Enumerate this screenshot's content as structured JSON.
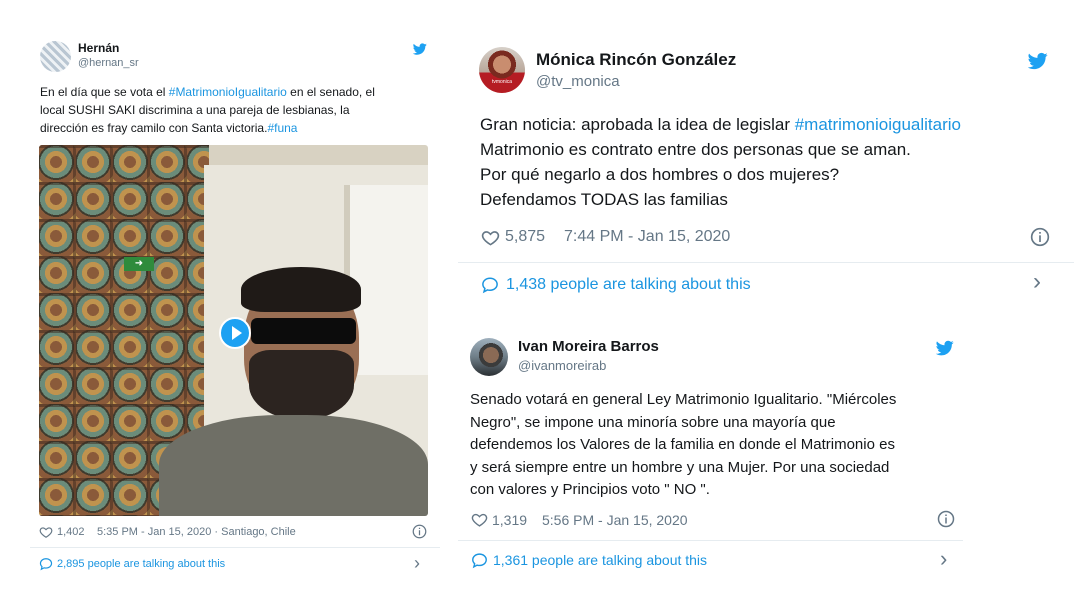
{
  "tweet1": {
    "name": "Hernán",
    "handle": "@hernan_sr",
    "text_lines": [
      [
        {
          "t": "En el día que se vota el "
        },
        {
          "t": "#MatrimonioIgualitario",
          "h": true
        },
        {
          "t": " en el senado, el"
        }
      ],
      [
        {
          "t": "local SUSHI SAKI discrimina a una pareja de lesbianas, la"
        }
      ],
      [
        {
          "t": "dirección es fray camilo con Santa victoria."
        },
        {
          "t": "#funa",
          "h": true
        }
      ]
    ],
    "likes": "1,402",
    "meta": "5:35 PM - Jan 15, 2020 · Santiago, Chile",
    "talking": "2,895 people are talking about this"
  },
  "tweet2": {
    "name": "Mónica Rincón González",
    "handle": "@tv_monica",
    "avatar_text": "tvmonica",
    "text_lines": [
      [
        {
          "t": "Gran noticia: aprobada la idea de legislar "
        },
        {
          "t": "#matrimonioigualitario",
          "h": true
        }
      ],
      [
        {
          "t": "Matrimonio es contrato entre dos personas que se aman."
        }
      ],
      [
        {
          "t": "Por qué negarlo a dos hombres o dos mujeres?"
        }
      ],
      [
        {
          "t": "Defendamos TODAS las familias"
        }
      ]
    ],
    "likes": "5,875",
    "meta": "7:44 PM - Jan 15, 2020",
    "talking": "1,438 people are talking about this"
  },
  "tweet3": {
    "name": "Ivan Moreira Barros",
    "handle": "@ivanmoreirab",
    "text_lines": [
      [
        {
          "t": "Senado votará en general Ley Matrimonio Igualitario. \"Miércoles"
        }
      ],
      [
        {
          "t": "Negro\", se impone una minoría sobre una mayoría que"
        }
      ],
      [
        {
          "t": "defendemos los Valores de la familia en donde el Matrimonio es"
        }
      ],
      [
        {
          "t": "y será siempre entre un hombre y una Mujer. Por una sociedad"
        }
      ],
      [
        {
          "t": "con valores y Principios voto \" NO \"."
        }
      ]
    ],
    "likes": "1,319",
    "meta": "5:56 PM - Jan 15, 2020",
    "talking": "1,361 people are talking about this"
  },
  "colors": {
    "link": "#1b95e0",
    "muted": "#657786",
    "divider": "#e6ecf0",
    "twitter_bird": "#1da1f2"
  }
}
